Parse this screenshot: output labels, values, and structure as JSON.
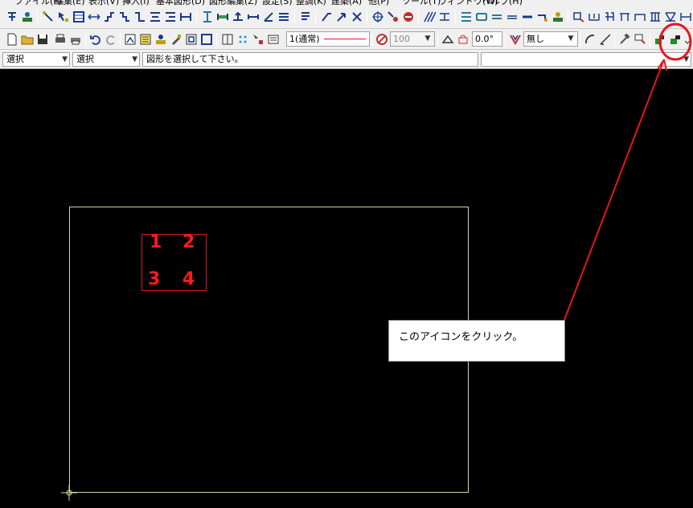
{
  "menu": {
    "items": [
      "ファイル(F)",
      "編集(E)",
      "表示(V)",
      "挿入(I)",
      "基本図形(D)",
      "図形編集(Z)",
      "設定(S)",
      "整調(K)",
      "建築(A)",
      "他(P)",
      "ツール(T)",
      "ウィンドウ(W)",
      "ヘルプ(H)"
    ]
  },
  "toolbar2": {
    "line_combo": "1(通常)",
    "scale_combo": "100",
    "angle_value": "0.0°",
    "fill_combo": "無し"
  },
  "status": {
    "mode1": "選択",
    "mode2": "選択",
    "message": "図形を選択して下さい。",
    "right_field": ""
  },
  "canvas": {
    "box_numbers": [
      "1",
      "2",
      "3",
      "4"
    ]
  },
  "annotation": {
    "callout_text": "このアイコンをクリック。",
    "highlight_color": "#e8141e"
  },
  "icons": {
    "target_icon": "layer-move-icon"
  }
}
